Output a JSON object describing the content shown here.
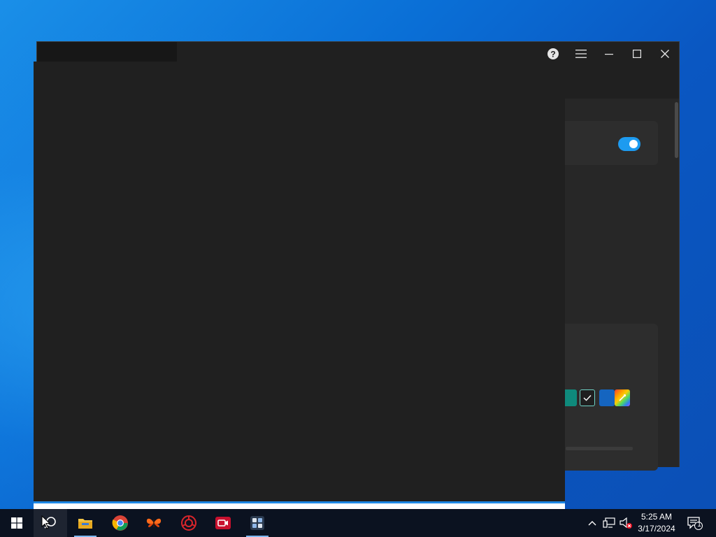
{
  "desktop": {
    "background": "#0a6fd6"
  },
  "window": {
    "title_buttons": {
      "help_icon": "help-icon",
      "menu_icon": "hamburger-menu-icon",
      "minimize_icon": "minimize-icon",
      "maximize_icon": "maximize-icon",
      "close_icon": "close-icon"
    },
    "toggle": {
      "state": "on",
      "color": "#1d9bf0"
    },
    "accent_swatches": [
      {
        "name": "teal",
        "color": "#0f8a7c",
        "selected": false
      },
      {
        "name": "selected-accent",
        "color": "#1f1f1f",
        "selected": true
      },
      {
        "name": "blue",
        "color": "#1565c0",
        "selected": false
      },
      {
        "name": "custom-color-picker",
        "color": "gradient",
        "selected": false
      }
    ]
  },
  "taskbar": {
    "apps": [
      {
        "name": "start-button",
        "icon": "windows-logo-icon"
      },
      {
        "name": "search",
        "icon": "search-icon"
      },
      {
        "name": "file-explorer",
        "icon": "folder-icon"
      },
      {
        "name": "chrome",
        "icon": "chrome-icon"
      },
      {
        "name": "butterfly-app",
        "icon": "butterfly-icon"
      },
      {
        "name": "red-app",
        "icon": "red-gear-icon"
      },
      {
        "name": "screen-recorder",
        "icon": "camera-icon"
      },
      {
        "name": "settings-app",
        "icon": "app-grid-icon"
      }
    ],
    "tray": {
      "chevron": "chevron-up-icon",
      "network": "network-icon",
      "volume": "volume-muted-icon",
      "notification_count": "1"
    },
    "clock": {
      "time": "5:25 AM",
      "date": "3/17/2024"
    }
  }
}
